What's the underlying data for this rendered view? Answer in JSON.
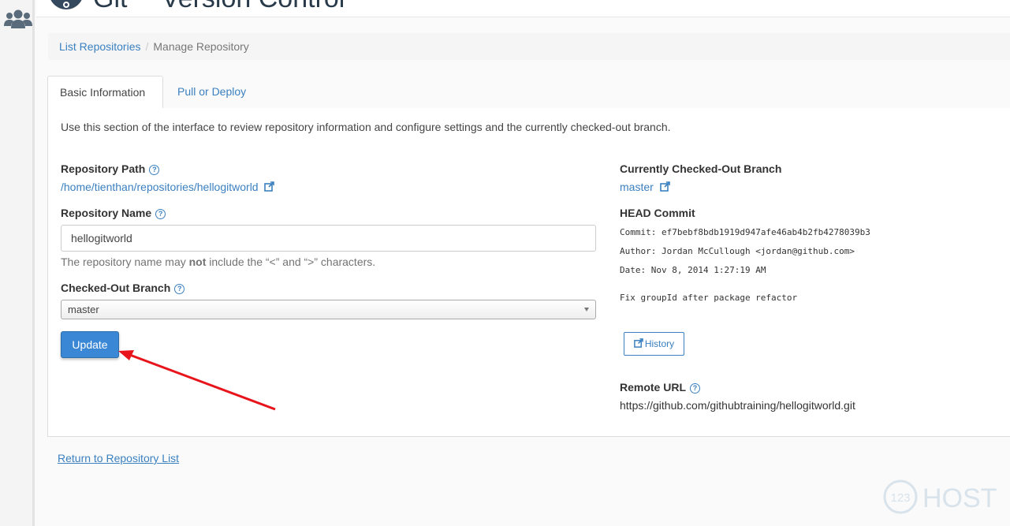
{
  "header": {
    "title": "Git™ Version Control"
  },
  "breadcrumb": {
    "list_label": "List Repositories",
    "separator": "/",
    "current": "Manage Repository"
  },
  "tabs": [
    {
      "label": "Basic Information"
    },
    {
      "label": "Pull or Deploy"
    }
  ],
  "panel": {
    "intro": "Use this section of the interface to review repository information and configure settings and the currently checked-out branch.",
    "repo_path_label": "Repository Path",
    "repo_path_value": "/home/tienthan/repositories/hellogitworld",
    "repo_name_label": "Repository Name",
    "repo_name_value": "hellogitworld",
    "hint_before": "The repository name may ",
    "hint_bold": "not",
    "hint_after": " include the “<” and “>” characters.",
    "branch_label": "Checked-Out Branch",
    "branch_value": "master",
    "update_button": "Update",
    "current_branch_label": "Currently Checked-Out Branch",
    "current_branch_value": "master",
    "head_commit_label": "HEAD Commit",
    "commit_key": "Commit:",
    "commit_value": "ef7bebf8bdb1919d947afe46ab4b2fb4278039b3",
    "author_key": "Author:",
    "author_value": "Jordan McCullough <jordan@github.com>",
    "date_key": "Date:",
    "date_value": "Nov 8, 2014 1:27:19 AM",
    "commit_message": "Fix groupId after package refactor",
    "history_button": "History",
    "remote_url_label": "Remote URL",
    "remote_url_value": "https://github.com/githubtraining/hellogitworld.git"
  },
  "footer": {
    "return_link": "Return to Repository List"
  },
  "watermark": {
    "text": "HOST",
    "badge": "123"
  },
  "colors": {
    "link": "#3b80c0",
    "primary_button": "#3a87d6",
    "annotation_arrow": "#e8141b"
  }
}
